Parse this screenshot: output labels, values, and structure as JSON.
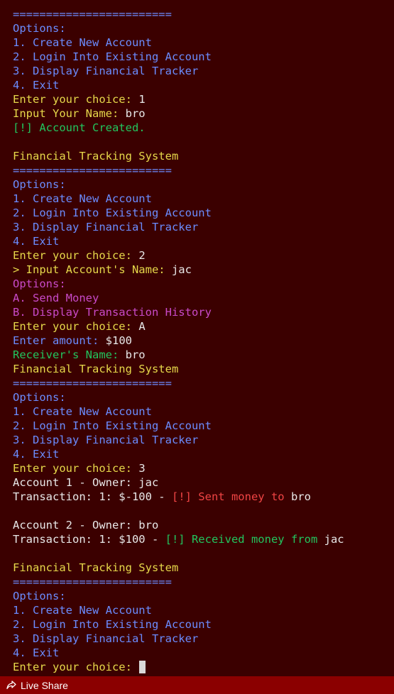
{
  "terminal": {
    "lines": [
      [
        {
          "t": "========================",
          "c": "blue"
        }
      ],
      [
        {
          "t": "Options:",
          "c": "blue"
        }
      ],
      [
        {
          "t": "1. Create New Account",
          "c": "blue"
        }
      ],
      [
        {
          "t": "2. Login Into Existing Account",
          "c": "blue"
        }
      ],
      [
        {
          "t": "3. Display Financial Tracker",
          "c": "blue"
        }
      ],
      [
        {
          "t": "4. Exit",
          "c": "blue"
        }
      ],
      [
        {
          "t": "Enter your choice: ",
          "c": "yellow"
        },
        {
          "t": "1",
          "c": "white"
        }
      ],
      [
        {
          "t": "Input Your Name: ",
          "c": "yellow"
        },
        {
          "t": "bro",
          "c": "white"
        }
      ],
      [
        {
          "t": "[!] Account Created.",
          "c": "green"
        }
      ],
      [],
      [
        {
          "t": "Financial Tracking System",
          "c": "yellow"
        }
      ],
      [
        {
          "t": "========================",
          "c": "blue"
        }
      ],
      [
        {
          "t": "Options:",
          "c": "blue"
        }
      ],
      [
        {
          "t": "1. Create New Account",
          "c": "blue"
        }
      ],
      [
        {
          "t": "2. Login Into Existing Account",
          "c": "blue"
        }
      ],
      [
        {
          "t": "3. Display Financial Tracker",
          "c": "blue"
        }
      ],
      [
        {
          "t": "4. Exit",
          "c": "blue"
        }
      ],
      [
        {
          "t": "Enter your choice: ",
          "c": "yellow"
        },
        {
          "t": "2",
          "c": "white"
        }
      ],
      [
        {
          "t": "> Input Account's Name: ",
          "c": "yellow"
        },
        {
          "t": "jac",
          "c": "white"
        }
      ],
      [
        {
          "t": "Options:",
          "c": "magenta"
        }
      ],
      [
        {
          "t": "A. Send Money",
          "c": "magenta"
        }
      ],
      [
        {
          "t": "B. Display Transaction History",
          "c": "magenta"
        }
      ],
      [
        {
          "t": "Enter your choice: ",
          "c": "yellow"
        },
        {
          "t": "A",
          "c": "white"
        }
      ],
      [
        {
          "t": "Enter amount: ",
          "c": "blue"
        },
        {
          "t": "$100",
          "c": "white"
        }
      ],
      [
        {
          "t": "Receiver's Name: ",
          "c": "green"
        },
        {
          "t": "bro",
          "c": "white"
        }
      ],
      [
        {
          "t": "Financial Tracking System",
          "c": "yellow"
        }
      ],
      [
        {
          "t": "========================",
          "c": "blue"
        }
      ],
      [
        {
          "t": "Options:",
          "c": "blue"
        }
      ],
      [
        {
          "t": "1. Create New Account",
          "c": "blue"
        }
      ],
      [
        {
          "t": "2. Login Into Existing Account",
          "c": "blue"
        }
      ],
      [
        {
          "t": "3. Display Financial Tracker",
          "c": "blue"
        }
      ],
      [
        {
          "t": "4. Exit",
          "c": "blue"
        }
      ],
      [
        {
          "t": "Enter your choice: ",
          "c": "yellow"
        },
        {
          "t": "3",
          "c": "white"
        }
      ],
      [
        {
          "t": "Account 1 - Owner: jac",
          "c": "white"
        }
      ],
      [
        {
          "t": "Transaction: 1: $-100 - ",
          "c": "white"
        },
        {
          "t": "[!] Sent money to ",
          "c": "red"
        },
        {
          "t": "bro",
          "c": "white"
        }
      ],
      [],
      [
        {
          "t": "Account 2 - Owner: bro",
          "c": "white"
        }
      ],
      [
        {
          "t": "Transaction: 1: $100 - ",
          "c": "white"
        },
        {
          "t": "[!] Received money from ",
          "c": "green"
        },
        {
          "t": "jac",
          "c": "white"
        }
      ],
      [],
      [
        {
          "t": "Financial Tracking System",
          "c": "yellow"
        }
      ],
      [
        {
          "t": "========================",
          "c": "blue"
        }
      ],
      [
        {
          "t": "Options:",
          "c": "blue"
        }
      ],
      [
        {
          "t": "1. Create New Account",
          "c": "blue"
        }
      ],
      [
        {
          "t": "2. Login Into Existing Account",
          "c": "blue"
        }
      ],
      [
        {
          "t": "3. Display Financial Tracker",
          "c": "blue"
        }
      ],
      [
        {
          "t": "4. Exit",
          "c": "blue"
        }
      ],
      [
        {
          "t": "Enter your choice: ",
          "c": "yellow"
        }
      ]
    ]
  },
  "statusbar": {
    "live_share_label": "Live Share",
    "live_share_icon": "live-share-icon"
  },
  "colors": {
    "background": "#3b0000",
    "statusbar": "#8b0000",
    "blue": "#6b8cff",
    "yellow": "#e6d84a",
    "white": "#e8e8e8",
    "green": "#22c55e",
    "red": "#ef4444",
    "magenta": "#c94ac9"
  }
}
